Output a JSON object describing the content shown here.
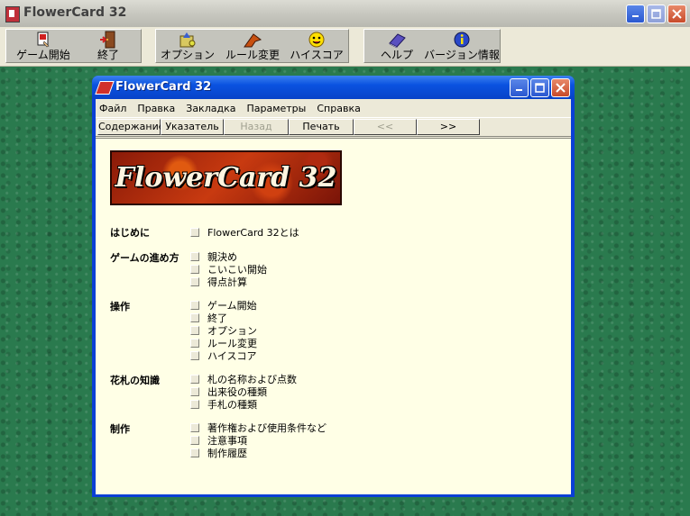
{
  "main": {
    "title": "FlowerCard 32",
    "toolbar": [
      {
        "label": "ゲーム開始",
        "icon": "game-start-icon"
      },
      {
        "label": "終了",
        "icon": "exit-door-icon"
      },
      {
        "label": "オプション",
        "icon": "option-icon"
      },
      {
        "label": "ルール変更",
        "icon": "rule-change-icon"
      },
      {
        "label": "ハイスコア",
        "icon": "smiley-icon"
      },
      {
        "label": "ヘルプ",
        "icon": "help-book-icon"
      },
      {
        "label": "バージョン情報",
        "icon": "info-icon"
      }
    ]
  },
  "help": {
    "title": "FlowerCard 32",
    "menu": [
      "Файл",
      "Правка",
      "Закладка",
      "Параметры",
      "Справка"
    ],
    "buttons": [
      "Содержание",
      "Указатель",
      "Назад",
      "Печать",
      "<<",
      ">>"
    ],
    "banner": "FlowerCard 32",
    "sections": [
      {
        "title": "はじめに",
        "items": [
          "FlowerCard 32とは"
        ]
      },
      {
        "title": "ゲームの進め方",
        "items": [
          "親決め",
          "こいこい開始",
          "得点計算"
        ]
      },
      {
        "title": "操作",
        "items": [
          "ゲーム開始",
          "終了",
          "オプション",
          "ルール変更",
          "ハイスコア"
        ]
      },
      {
        "title": "花札の知識",
        "items": [
          "札の名称および点数",
          "出来役の種類",
          "手札の種類"
        ]
      },
      {
        "title": "制作",
        "items": [
          "著作権および使用条件など",
          "注意事項",
          "制作履歴"
        ]
      }
    ]
  }
}
